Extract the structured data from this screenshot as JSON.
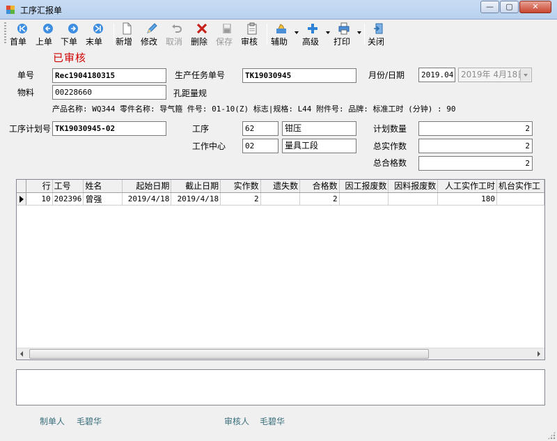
{
  "window": {
    "title": "工序汇报单",
    "minimize_glyph": "—",
    "maximize_glyph": "▢",
    "close_glyph": "✕"
  },
  "toolbar": {
    "first": "首单",
    "prev": "上单",
    "next": "下单",
    "last": "末单",
    "new": "新增",
    "edit": "修改",
    "cancel": "取消",
    "delete": "删除",
    "save": "保存",
    "audit": "审核",
    "assist": "辅助",
    "advanced": "高级",
    "print": "打印",
    "close": "关闭"
  },
  "status_stamp": "已审核",
  "form": {
    "doc_no_label": "单号",
    "doc_no": "Rec1904180315",
    "prod_task_label": "生产任务单号",
    "prod_task_no": "TK19030945",
    "month_date_label": "月份/日期",
    "month": "2019.04",
    "date": "2019年  4月18日",
    "material_label": "物料",
    "material_code": "00228660",
    "material_name": "孔距量规",
    "product_info": "产品名称: WQ344 零件名称: 导气箍 件号: 01-10(Z) 标志|规格: L44 附件号:  品牌:  标准工时 (分钟) : 90",
    "process_plan_label": "工序计划号",
    "process_plan_no": "TK19030945-02",
    "process_label": "工序",
    "process_code": "62",
    "process_name": "钳压",
    "work_center_label": "工作中心",
    "work_center_code": "02",
    "work_center_name": "量具工段",
    "planned_qty_label": "计划数量",
    "planned_qty": "2",
    "total_actual_label": "总实作数",
    "total_actual": "2",
    "total_qualified_label": "总合格数",
    "total_qualified": "2"
  },
  "grid": {
    "columns": [
      "行",
      "工号",
      "姓名",
      "起始日期",
      "截止日期",
      "实作数",
      "遗失数",
      "合格数",
      "因工报废数",
      "因料报废数",
      "人工实作工时",
      "机台实作工"
    ],
    "rows": [
      [
        "10",
        "202396",
        "曾强",
        "2019/4/18",
        "2019/4/18",
        "2",
        "",
        "2",
        "",
        "",
        "180",
        ""
      ]
    ]
  },
  "footer": {
    "creator_label": "制单人",
    "creator": "毛碧华",
    "auditor_label": "审核人",
    "auditor": "毛碧华"
  },
  "colors": {
    "stamp": "#d00000",
    "footer_text": "#3a6f7c",
    "titlebar": "#c9dcf3"
  }
}
